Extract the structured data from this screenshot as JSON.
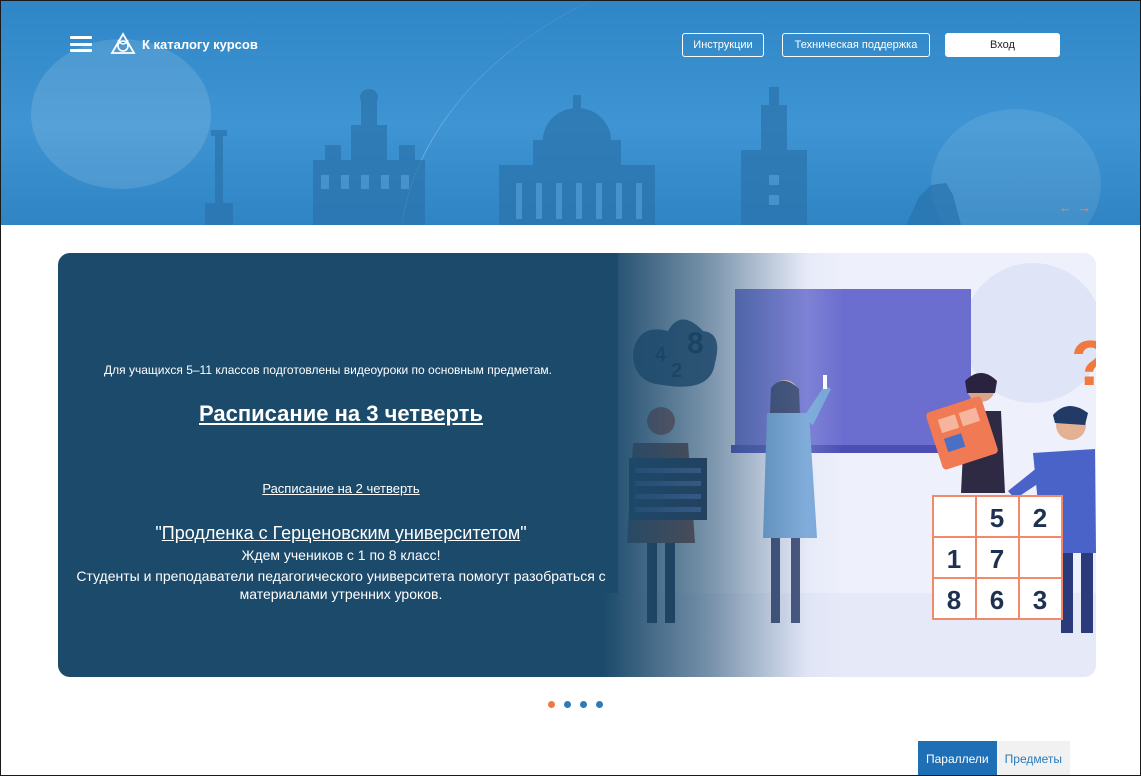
{
  "header": {
    "catalog_link": "К каталогу курсов",
    "instructions_button": "Инструкции",
    "support_button": "Техническая поддержка",
    "login_button": "Вход",
    "prev_arrow": "←",
    "next_arrow": "→"
  },
  "banner": {
    "intro_text": "Для учащихся 5–11 классов подготовлены видеоуроки по основным предметам.",
    "schedule_q3_link": "Расписание на 3 четверть",
    "schedule_q2_link": "Расписание на 2 четверть",
    "prodlenka_quote_open": "\"",
    "prodlenka_link": "Продленка с Герценовским университетом",
    "prodlenka_quote_close": "\"",
    "waiting_text": "Ждем учеников с 1 по 8 класс!",
    "students_text": "Студенты и преподаватели педагогического университета помогут разобраться с материалами утренних уроков.",
    "grid_numbers": [
      "",
      "5",
      "2",
      "1",
      "7",
      "",
      "8",
      "6",
      "3"
    ],
    "question_mark": "?",
    "bubble_numbers": [
      "4",
      "2",
      "8"
    ]
  },
  "carousel": {
    "active_index": 0,
    "count": 4
  },
  "tabs": {
    "parallels": "Параллели",
    "subjects": "Предметы"
  },
  "colors": {
    "header_blue": "#3a90cf",
    "banner_dark": "#1c4a6b",
    "accent_orange": "#f07a3e",
    "tab_active": "#1e6fb5"
  }
}
